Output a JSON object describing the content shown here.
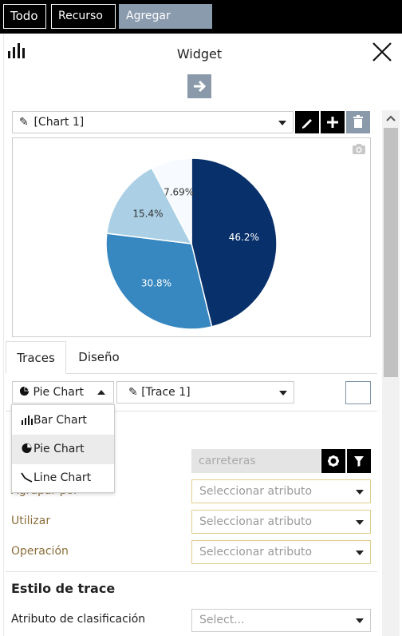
{
  "topbar": {
    "todo": "Todo",
    "recurso": "Recurso",
    "agregar": "Agregar widget"
  },
  "header": {
    "title": "Widget"
  },
  "chart_selector": {
    "value": "[Chart 1]"
  },
  "tabs": {
    "traces": "Traces",
    "diseno": "Diseño"
  },
  "chart_type_select": {
    "value": "Pie Chart"
  },
  "chart_type_menu": {
    "items": [
      "Bar Chart",
      "Pie Chart",
      "Line Chart"
    ],
    "selected": "Pie Chart"
  },
  "trace_selector": {
    "value": "[Trace 1]"
  },
  "fields": {
    "resource_input": "carreteras",
    "agrupar_label": "Agrupar por",
    "agrupar_placeholder": "Seleccionar atributo",
    "utilizar_label": "Utilizar",
    "utilizar_placeholder": "Seleccionar atributo",
    "operacion_label": "Operación",
    "operacion_placeholder": "Seleccionar atributo"
  },
  "trace_style": {
    "title": "Estilo de trace",
    "clasificacion_label": "Atributo de clasificación",
    "clasificacion_placeholder": "Select..."
  },
  "colors": {
    "accent_grey": "#8b9aab",
    "label_gold": "#8b6e3a",
    "field_border": "#e0cd8c"
  },
  "chart_data": {
    "type": "pie",
    "slices": [
      {
        "value": 46.2,
        "label": "46.2%",
        "color": "#08306b"
      },
      {
        "value": 30.8,
        "label": "30.8%",
        "color": "#3787c0"
      },
      {
        "value": 15.4,
        "label": "15.4%",
        "color": "#abd0e6"
      },
      {
        "value": 7.69,
        "label": "7.69%",
        "color": "#f7fbff"
      }
    ]
  }
}
